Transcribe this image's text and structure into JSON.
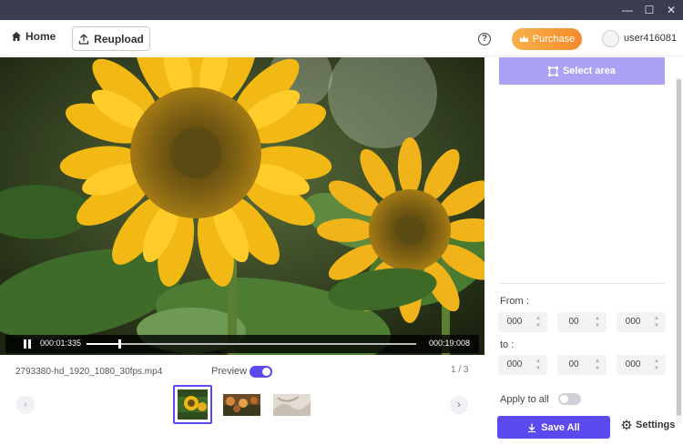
{
  "window": {
    "controls": {
      "minimize": "—",
      "maximize": "☐",
      "close": "✕"
    }
  },
  "topbar": {
    "home_label": "Home",
    "reupload_label": "Reupload",
    "help_symbol": "?",
    "purchase_label": "Purchase",
    "username": "user416081"
  },
  "player": {
    "current_time": "000:01:335",
    "total_time": "000:19:008",
    "progress_fraction": 0.1
  },
  "file": {
    "name": "2793380-hd_1920_1080_30fps.mp4",
    "preview_label": "Preview",
    "preview_on": true,
    "page_indicator": "1 / 3"
  },
  "thumbnails": [
    {
      "name": "sunflower",
      "selected": true
    },
    {
      "name": "flowers-field",
      "selected": false
    },
    {
      "name": "white-fabric",
      "selected": false
    }
  ],
  "side_panel": {
    "select_area_label": "Select area",
    "from_label": "From :",
    "from_values": [
      "000",
      "00",
      "000"
    ],
    "to_label": "to :",
    "to_values": [
      "000",
      "00",
      "000"
    ],
    "apply_label": "Apply to all",
    "apply_on": false,
    "save_all_label": "Save All",
    "settings_label": "Settings"
  },
  "colors": {
    "accent": "#5b4af0",
    "accent_light": "#a9a2f5",
    "purchase": "#f58a2c",
    "titlebar": "#3b3b52"
  },
  "icons": {
    "home": "home-icon",
    "reupload": "upload-icon",
    "purchase": "crown-icon",
    "select_area": "crop-icon",
    "save": "download-icon",
    "settings": "gear-icon"
  }
}
